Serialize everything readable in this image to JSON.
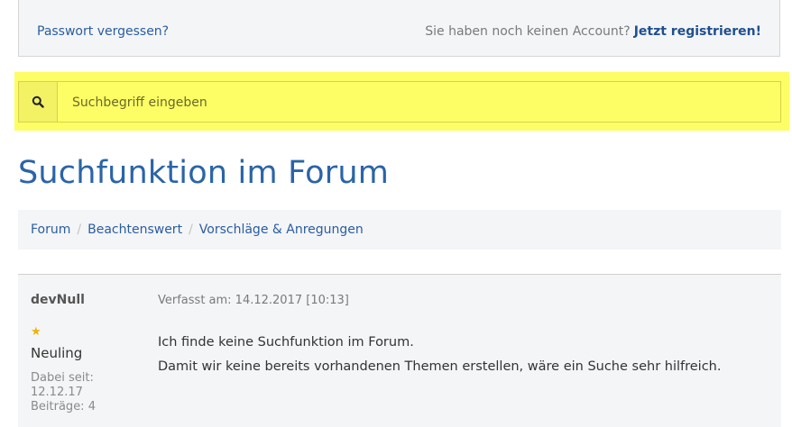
{
  "login_footer": {
    "forgot_password": "Passwort vergessen?",
    "no_account_text": "Sie haben noch keinen Account?",
    "register_link": "Jetzt registrieren!"
  },
  "search": {
    "placeholder": "Suchbegriff eingeben",
    "icon": "search-icon"
  },
  "page": {
    "title": "Suchfunktion im Forum"
  },
  "breadcrumb": [
    "Forum",
    "Beachtenswert",
    "Vorschläge & Anregungen"
  ],
  "post": {
    "author": "devNull",
    "rank_icon": "★",
    "rank": "Neuling",
    "joined_label": "Dabei seit:",
    "joined_date": "12.12.17",
    "posts": "Beiträge: 4",
    "posted": "Verfasst am: 14.12.2017 [10:13]",
    "lines": [
      "Ich finde keine Suchfunktion im Forum.",
      "Damit wir keine bereits vorhandenen Themen erstellen, wäre ein Suche sehr hilfreich."
    ]
  },
  "colors": {
    "accent": "#2a64a8",
    "highlight": "#fdfd66"
  }
}
